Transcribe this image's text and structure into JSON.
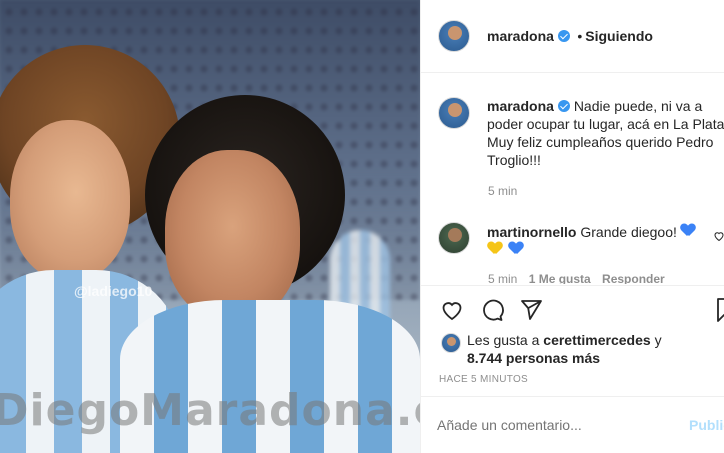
{
  "photo": {
    "handle_overlay": "@ladiego10",
    "watermark": "DiegoMaradona.com"
  },
  "header": {
    "username": "maradona",
    "separator": "•",
    "follow_status": "Siguiendo"
  },
  "caption": {
    "username": "maradona",
    "text_line1": "Nadie puede, ni va a",
    "text_line2": "poder ocupar tu lugar, acá en La Plata.",
    "text_line3": "Muy feliz cumpleaños querido Pedro",
    "text_line4": "Troglio!!!",
    "time": "5 min"
  },
  "comment": {
    "username": "martinornello",
    "text": "Grande diegoo!",
    "time": "5 min",
    "likes": "1 Me gusta",
    "reply": "Responder"
  },
  "likes": {
    "prefix": "Les gusta a",
    "user": "cerettimercedes",
    "conjunction": "y",
    "others": "8.744 personas más"
  },
  "timestamp": "HACE 5 MINUTOS",
  "comment_box": {
    "placeholder": "Añade un comentario...",
    "publish_label": "Publicar"
  },
  "colors": {
    "verified_blue": "#3897f0",
    "publish_disabled": "#b2dffc",
    "meta_gray": "#8e8e8e"
  }
}
